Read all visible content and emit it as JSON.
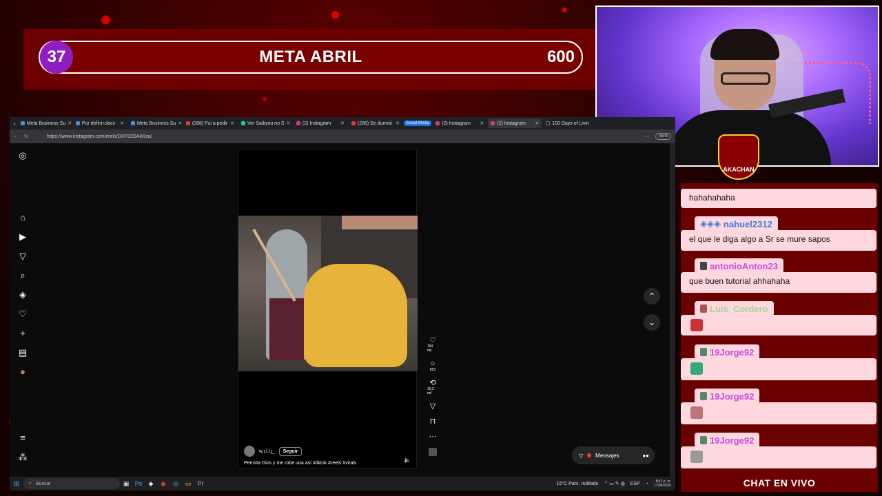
{
  "overlay": {
    "goal_start": "37",
    "goal_title": "META ABRIL",
    "goal_end": "600",
    "logo_text": "AKACHAN",
    "chat_footer": "CHAT EN VIVO"
  },
  "browser": {
    "tabs": [
      {
        "label": "Meta Business Su"
      },
      {
        "label": "Por definir.docx"
      },
      {
        "label": "Meta Business Su"
      },
      {
        "label": "(288) Fui a pedir"
      },
      {
        "label": "Ver Saikyou no S"
      },
      {
        "label": "(2) Instagram"
      },
      {
        "label": "(288) Se durmió"
      },
      {
        "label": "(2) Instagram"
      },
      {
        "label": "(2) Instagram"
      },
      {
        "label": "100 Days of Livin"
      }
    ],
    "tab_group": "Social Media",
    "url": "https://www.instagram.com/reels/DXF92OAkRza/",
    "verify_label": "Verifi"
  },
  "reel": {
    "username": "w.i.l.l.j_",
    "follow_label": "Seguir",
    "caption": "Permita Dios y me robe una así #tiktok #reels #virals",
    "likes": "154 mil",
    "comments": "853",
    "reposts": "19,2 mil"
  },
  "messages": {
    "label": "Mensajes",
    "count": "2"
  },
  "taskbar": {
    "search_placeholder": "Buscar",
    "weather": "16°C Parc. nublado",
    "lang": "ESP",
    "time": "8:41 p. m.",
    "date": "17/04/2026"
  },
  "chat": {
    "messages": [
      {
        "user": "",
        "text": "hahahahaha"
      },
      {
        "user": "nahuel2312",
        "user_color": "#3a7fd5",
        "text": "el que le diga algo a Sr se mure sapos"
      },
      {
        "user": "antonioAnton23",
        "user_color": "#c84fe0",
        "text": "que buen tutorial ahhahaha"
      },
      {
        "user": "Luis_Cordero",
        "user_color": "#62d46a",
        "text": ""
      },
      {
        "user": "19Jorge92",
        "user_color": "#c84fe0",
        "text": ""
      },
      {
        "user": "19Jorge92",
        "user_color": "#c84fe0",
        "text": ""
      },
      {
        "user": "19Jorge92",
        "user_color": "#c84fe0",
        "text": ""
      }
    ]
  },
  "colors": {
    "goal_purple": "#8e1ec0",
    "overlay_red": "#6a0000",
    "chat_bg": "#ffd7de"
  }
}
